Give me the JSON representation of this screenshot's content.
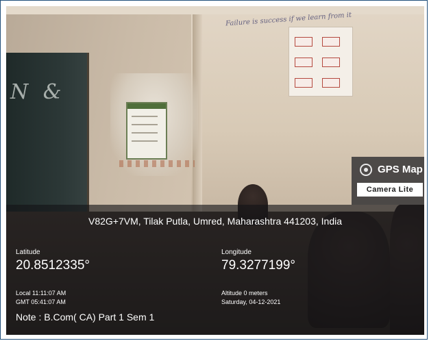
{
  "overlay": {
    "address": "V82G+7VM, Tilak Putla, Umred, Maharashtra 441203, India",
    "latitude_label": "Latitude",
    "latitude_value": "20.8512335°",
    "longitude_label": "Longitude",
    "longitude_value": "79.3277199°",
    "local_time": "Local 11:11:07 AM",
    "gmt_time": "GMT 05:41:07 AM",
    "altitude": "Altitude 0 meters",
    "date": "Saturday, 04-12-2021",
    "note": "Note : B.Com( CA) Part 1 Sem 1"
  },
  "badge": {
    "title": "GPS Map",
    "subtitle": "Camera Lite",
    "icon": "camera-lens-icon"
  },
  "scene": {
    "blackboard_text": "N &",
    "wall_text": "Failure is success if we learn from it"
  }
}
